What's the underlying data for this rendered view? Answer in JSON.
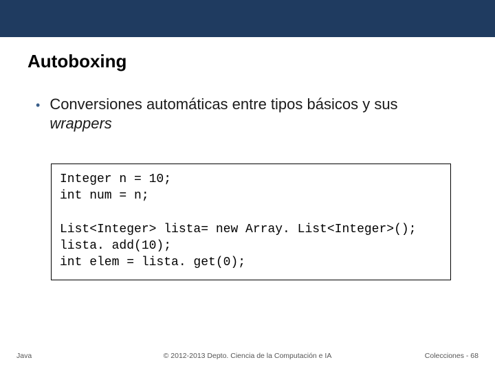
{
  "title": "Autoboxing",
  "bullet": {
    "pre": "Conversiones automáticas entre tipos básicos y sus ",
    "italic": "wrappers"
  },
  "code": "Integer n = 10;\nint num = n;\n\nList<Integer> lista= new Array. List<Integer>();\nlista. add(10);\nint elem = lista. get(0);",
  "footer": {
    "left": "Java",
    "center": "© 2012-2013 Depto. Ciencia de la Computación e IA",
    "right": "Colecciones - 68"
  }
}
